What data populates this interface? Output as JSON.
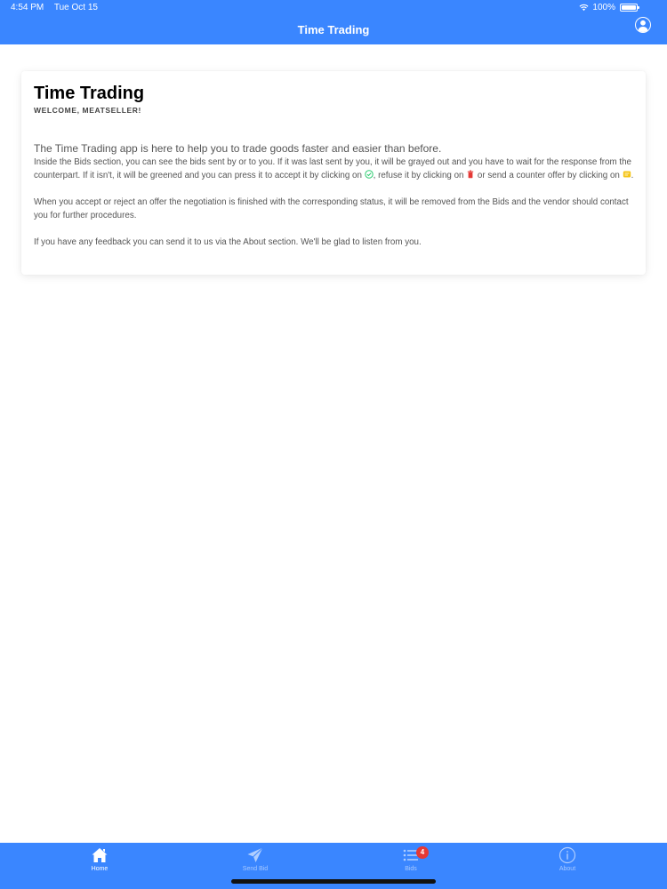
{
  "status_bar": {
    "time": "4:54 PM",
    "date": "Tue Oct 15",
    "battery": "100%"
  },
  "nav": {
    "title": "Time Trading",
    "profile_icon": "person-circle-icon"
  },
  "card": {
    "title": "Time Trading",
    "subtitle": "WELCOME, MEATSELLER!",
    "lead": "The Time Trading app is here to help you to trade goods faster and easier than before.",
    "p1_a": "Inside the Bids section, you can see the bids sent by or to you. If it was last sent by you, it will be grayed out and you have to wait for the response from the counterpart. If it isn't, it will be greened and you can press it to accept it by clicking on",
    "p1_b": ", refuse it by clicking on",
    "p1_c": " or send a counter offer by clicking on",
    "p1_d": ".",
    "p2": "When you accept or reject an offer the negotiation is finished with the corresponding status, it will be removed from the Bids and the vendor should contact you for further procedures.",
    "p3": "If you have any feedback you can send it to us via the About section. We'll be glad to listen from you."
  },
  "colors": {
    "primary": "#3a86ff",
    "accept": "#2ecc71",
    "refuse": "#e53935",
    "counter": "#f5c518"
  },
  "tabs": [
    {
      "label": "Home",
      "icon": "home-icon",
      "active": true
    },
    {
      "label": "Send Bid",
      "icon": "paper-plane-icon",
      "active": false
    },
    {
      "label": "Bids",
      "icon": "list-icon",
      "active": false,
      "badge": "4"
    },
    {
      "label": "About",
      "icon": "info-icon",
      "active": false
    }
  ]
}
